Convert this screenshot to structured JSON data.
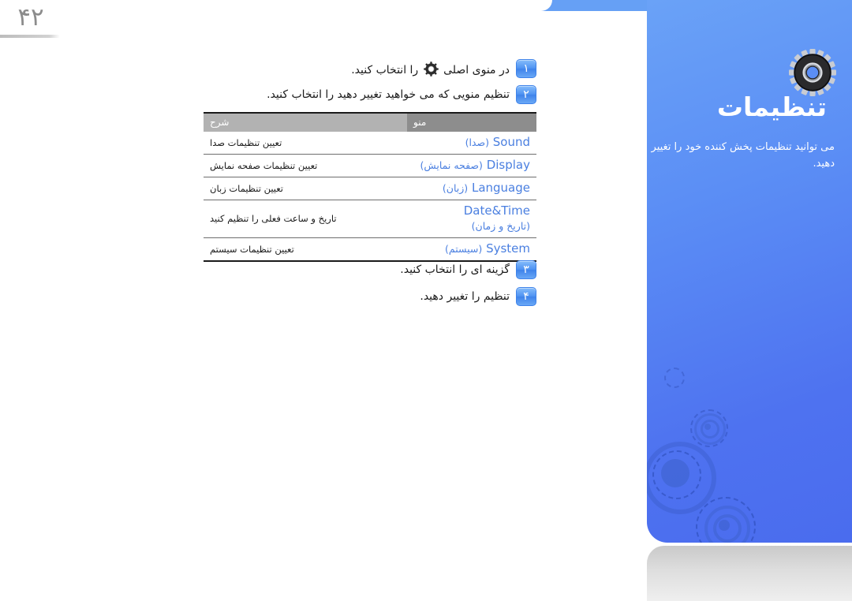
{
  "page": {
    "number": "۴۲"
  },
  "panel": {
    "title": "تنظیمات",
    "description": "می توانید تنظیمات پخش کننده خود را تغییر دهید.",
    "icon": "gear-icon",
    "background_color": "#5b8ef5",
    "title_color": "#ffffff"
  },
  "steps_top": [
    {
      "badge": "۱",
      "text_before": "در منوی اصلی",
      "icon": "gear-icon",
      "text_after": "را انتخاب کنید."
    },
    {
      "badge": "۲",
      "text": "تنظیم منویی که می خواهید تغییر دهید را انتخاب کنید."
    }
  ],
  "steps_bottom": [
    {
      "badge": "۳",
      "text": "گزینه ای را انتخاب کنید."
    },
    {
      "badge": "۴",
      "text": "تنظیم را تغییر دهید."
    }
  ],
  "table": {
    "headers": {
      "menu": "منو",
      "description": "شرح"
    },
    "rows": [
      {
        "menu_en": "Sound",
        "menu_fa": "(صدا)",
        "menu_fa2": "",
        "description": "تعیین تنظیمات صدا"
      },
      {
        "menu_en": "Display",
        "menu_fa": "(صفحه نمایش)",
        "menu_fa2": "",
        "description": "تعیین تنظیمات صفحه نمایش"
      },
      {
        "menu_en": "Language",
        "menu_fa": "(زبان)",
        "menu_fa2": "",
        "description": "تعیین تنظیمات زبان"
      },
      {
        "menu_en": "Date&Time",
        "menu_fa": "",
        "menu_fa2": "(تاریخ و زمان)",
        "description": "تاریخ و ساعت فعلی را تنظیم کنید"
      },
      {
        "menu_en": "System",
        "menu_fa": "(سیستم)",
        "menu_fa2": "",
        "description": "تعیین تنظیمات سیستم"
      }
    ]
  },
  "colors": {
    "accent_blue": "#4a7fe0",
    "panel_blue": "#5b8ef5",
    "header_dark_gray": "#8d8d8d",
    "header_light_gray": "#b2b2b2",
    "page_number_gray": "#8c8c8c"
  }
}
